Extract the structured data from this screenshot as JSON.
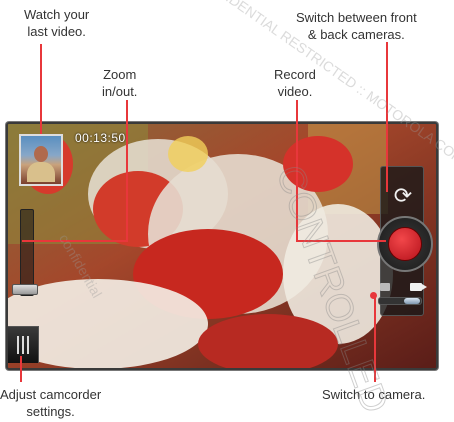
{
  "callouts": {
    "watch_last_video": "Watch your\nlast video.",
    "zoom": "Zoom\nin/out.",
    "record": "Record\nvideo.",
    "switch_cameras": "Switch between front\n& back cameras.",
    "adjust_settings": "Adjust camcorder\nsettings.",
    "switch_to_camera": "Switch to camera."
  },
  "viewfinder": {
    "timer": "00:13:50"
  },
  "watermark": {
    "text": "CONFIDENTIAL RESTRICTED :: MOTOROLA CONFIDENTIAL",
    "big": "CONTROLLED",
    "side": "confidential"
  },
  "icons": {
    "switch": "switch-camera-icon",
    "record": "record-icon",
    "settings": "settings-bars-icon",
    "camera": "camera-icon",
    "video": "video-icon"
  },
  "colors": {
    "callout_line": "#e8373b",
    "record": "#d8242b"
  }
}
